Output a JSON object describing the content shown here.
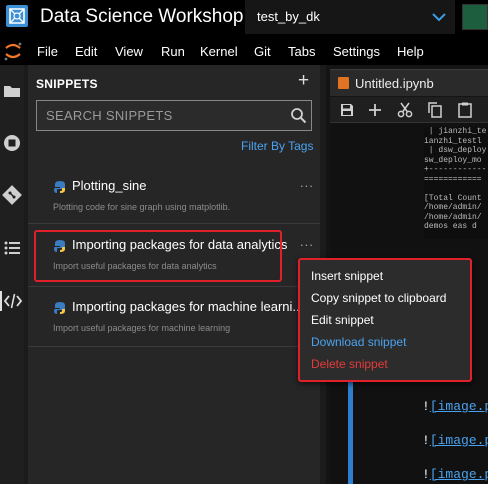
{
  "app": {
    "title": "Data Science Workshop"
  },
  "workspace": {
    "name": "test_by_dk"
  },
  "menu": [
    "File",
    "Edit",
    "View",
    "Run",
    "Kernel",
    "Git",
    "Tabs",
    "Settings",
    "Help"
  ],
  "sidebar": {
    "title": "SNIPPETS",
    "add_label": "+",
    "search_placeholder": "SEARCH SNIPPETS",
    "filter_label": "Filter By Tags",
    "snippets": [
      {
        "name": "Plotting_sine",
        "description": "Plotting code for sine graph using matplotlib.",
        "more": "..."
      },
      {
        "name": "Importing packages for data analytics",
        "description": "Import useful packages for data analytics",
        "more": "..."
      },
      {
        "name": "Importing packages for machine learni...",
        "description": "Import useful packages for machine learning",
        "more": "..."
      }
    ]
  },
  "notebook": {
    "tab_name": "Untitled.ipynb",
    "output_text": " | jianzhi_te\nianzhi_testl\n | dsw_deploy\nsw_deploy_mo\n+------------\n============\n\n[Total Count\n/home/admin/\n/home/admin/\ndemos eas d",
    "md_prefix": "!",
    "md_links": [
      "[image.p",
      "[image.p",
      "[image.p"
    ]
  },
  "context_menu": {
    "items": [
      {
        "label": "Insert snippet",
        "style": "normal"
      },
      {
        "label": "Copy snippet to clipboard",
        "style": "normal"
      },
      {
        "label": "Edit snippet",
        "style": "normal"
      },
      {
        "label": "Download snippet",
        "style": "blue"
      },
      {
        "label": "Delete snippet",
        "style": "red"
      }
    ]
  },
  "colors": {
    "accent_blue": "#4aa3f0",
    "highlight_red": "#e0202a",
    "delete_red": "#e53a3a",
    "notebook_orange": "#e07422"
  },
  "icons": [
    "app-logo-icon",
    "chevron-down-icon",
    "jupyter-icon",
    "folder-icon",
    "running-icon",
    "git-icon",
    "list-icon",
    "code-snippet-icon",
    "search-icon",
    "python-icon",
    "notebook-icon",
    "save-icon",
    "add-icon",
    "cut-icon",
    "copy-icon",
    "paste-icon"
  ]
}
